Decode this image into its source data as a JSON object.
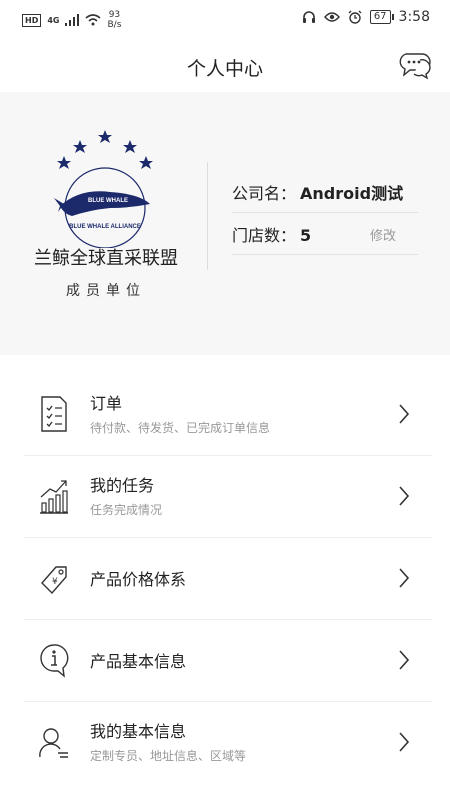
{
  "status_bar": {
    "hd": "HD",
    "network": "4G",
    "net_speed": "93",
    "net_speed_unit": "B/s",
    "battery": "67",
    "time": "3:58"
  },
  "header": {
    "title": "个人中心"
  },
  "profile": {
    "logo_text": "BLUE WHALE",
    "logo_arc_text": "BLUE WHALE ALLIANCE",
    "alliance_name": "兰鲸全球直采联盟",
    "member_label": "成员单位",
    "company_label": "公司名：",
    "company_value": "Android测试",
    "stores_label": "门店数：",
    "stores_value": "5",
    "edit_label": "修改"
  },
  "menu": [
    {
      "title": "订单",
      "subtitle": "待付款、待发货、已完成订单信息",
      "icon": "order-list-icon"
    },
    {
      "title": "我的任务",
      "subtitle": "任务完成情况",
      "icon": "task-chart-icon"
    },
    {
      "title": "产品价格体系",
      "subtitle": "",
      "icon": "price-tag-icon"
    },
    {
      "title": "产品基本信息",
      "subtitle": "",
      "icon": "info-icon"
    },
    {
      "title": "我的基本信息",
      "subtitle": "定制专员、地址信息、区域等",
      "icon": "user-icon"
    }
  ],
  "colors": {
    "brand_navy": "#1c2a6b",
    "background": "#f7f7f7"
  }
}
